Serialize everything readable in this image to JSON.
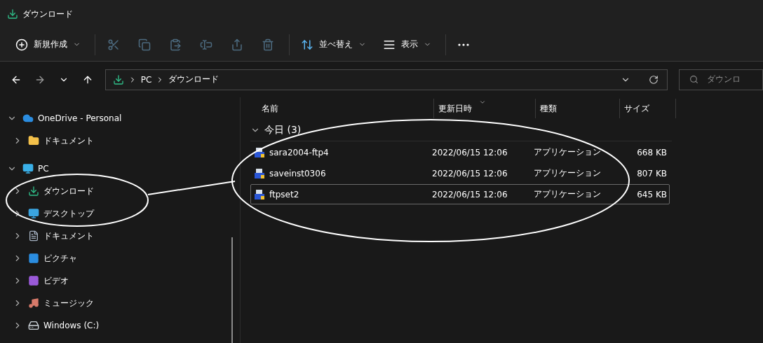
{
  "window": {
    "title": "ダウンロード"
  },
  "toolbar": [
    {
      "kind": "new",
      "label": "新規作成",
      "disabled": false
    },
    {
      "kind": "cut",
      "disabled": true
    },
    {
      "kind": "copy",
      "disabled": true
    },
    {
      "kind": "paste",
      "disabled": true
    },
    {
      "kind": "rename",
      "disabled": true
    },
    {
      "kind": "share",
      "disabled": true
    },
    {
      "kind": "delete",
      "disabled": true
    },
    {
      "kind": "sort",
      "label": "並べ替え",
      "disabled": false
    },
    {
      "kind": "view",
      "label": "表示",
      "disabled": false
    },
    {
      "kind": "more",
      "disabled": false
    }
  ],
  "address_bar": {
    "path": [
      "PC",
      "ダウンロード"
    ]
  },
  "search": {
    "placeholder": "ダウンロ"
  },
  "sidebar": {
    "items": [
      {
        "kind": "onedrive",
        "label": "OneDrive - Personal",
        "expanded": true,
        "children": [
          {
            "kind": "folder",
            "label": "ドキュメント",
            "expanded": false
          }
        ]
      },
      {
        "kind": "pc",
        "label": "PC",
        "expanded": true,
        "children": [
          {
            "kind": "download",
            "label": "ダウンロード",
            "expanded": false
          },
          {
            "kind": "desktop",
            "label": "デスクトップ",
            "expanded": false
          },
          {
            "kind": "documents",
            "label": "ドキュメント",
            "expanded": false
          },
          {
            "kind": "pictures",
            "label": "ピクチャ",
            "expanded": false
          },
          {
            "kind": "videos",
            "label": "ビデオ",
            "expanded": false
          },
          {
            "kind": "music",
            "label": "ミュージック",
            "expanded": false
          },
          {
            "kind": "drive",
            "label": "Windows (C:)",
            "expanded": false
          }
        ]
      }
    ]
  },
  "table": {
    "columns": [
      "名前",
      "更新日時",
      "種類",
      "サイズ"
    ],
    "groups": [
      {
        "label": "今日 (3)",
        "expanded": true,
        "rows": [
          {
            "name": "sara2004-ftp4",
            "modified": "2022/06/15 12:06",
            "type": "アプリケーション",
            "size": "668 KB",
            "selected": false
          },
          {
            "name": "saveinst0306",
            "modified": "2022/06/15 12:06",
            "type": "アプリケーション",
            "size": "807 KB",
            "selected": false
          },
          {
            "name": "ftpset2",
            "modified": "2022/06/15 12:06",
            "type": "アプリケーション",
            "size": "645 KB",
            "selected": true
          }
        ]
      }
    ]
  }
}
